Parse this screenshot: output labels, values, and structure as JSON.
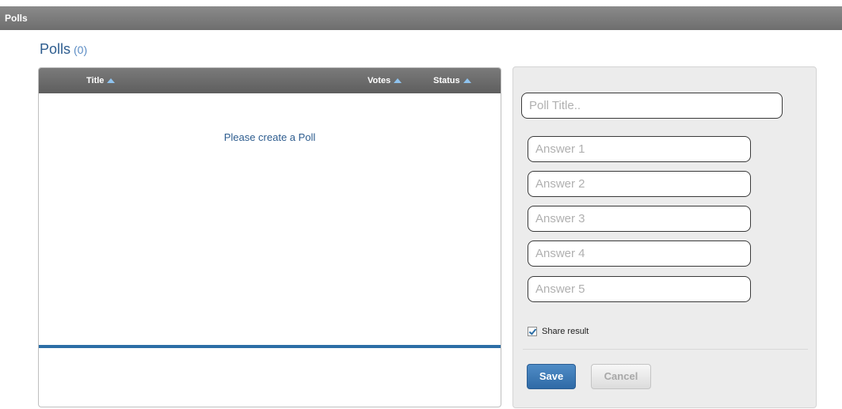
{
  "header": {
    "title": "Polls"
  },
  "page": {
    "heading": "Polls",
    "count": "(0)"
  },
  "list": {
    "columns": {
      "title": "Title",
      "votes": "Votes",
      "status": "Status"
    },
    "empty_message": "Please create a Poll"
  },
  "form": {
    "title_placeholder": "Poll Title..",
    "answers": [
      "Answer 1",
      "Answer 2",
      "Answer 3",
      "Answer 4",
      "Answer 5"
    ],
    "share_label": "Share result",
    "share_checked": true,
    "save_label": "Save",
    "cancel_label": "Cancel"
  },
  "colors": {
    "accent": "#2c6ea6",
    "heading": "#2e5d8f"
  }
}
